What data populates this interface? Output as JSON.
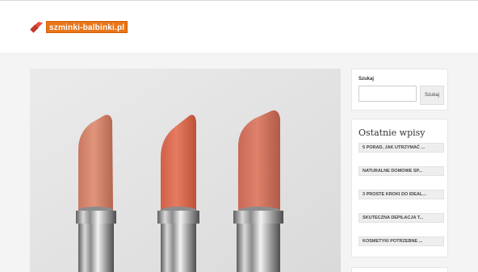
{
  "header": {
    "logo_text": "szminki-balbinki.pl"
  },
  "hero": {
    "image_name": "lipsticks-image"
  },
  "search": {
    "label": "Szukaj",
    "placeholder": "",
    "button_label": "Szukaj"
  },
  "recent": {
    "title": "Ostatnie wpisy",
    "items": [
      "5 PORAD, JAK UTRZYMAĆ ...",
      "NATURALNE DOMOWE SP...",
      "3 PROSTE KROKI DO IDEAL...",
      "SKUTECZNA DEPILACJA T...",
      "KOSMETYKI POTRZEBNE ..."
    ]
  },
  "colors": {
    "brand": "#e8751a",
    "background": "#f4f4f4"
  }
}
